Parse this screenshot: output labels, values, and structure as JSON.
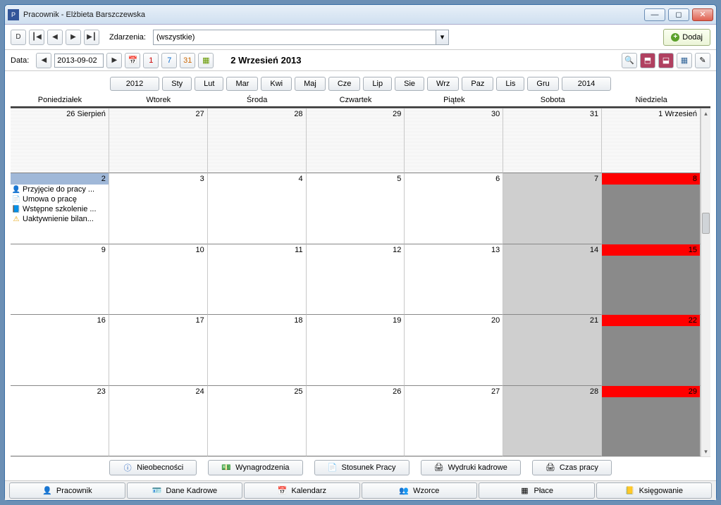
{
  "window": {
    "title": "Pracownik - Elżbieta Barszczewska"
  },
  "toolbar": {
    "events_label": "Zdarzenia:",
    "events_value": "(wszystkie)",
    "add_label": "Dodaj",
    "date_label": "Data:",
    "date_value": "2013-09-02",
    "selected_date": "2 Wrzesień 2013"
  },
  "months": {
    "prev_year": "2012",
    "list": [
      "Sty",
      "Lut",
      "Mar",
      "Kwi",
      "Maj",
      "Cze",
      "Lip",
      "Sie",
      "Wrz",
      "Paz",
      "Lis",
      "Gru"
    ],
    "next_year": "2014"
  },
  "weekdays": [
    "Poniedziałek",
    "Wtorek",
    "Środa",
    "Czwartek",
    "Piątek",
    "Sobota",
    "Niedziela"
  ],
  "grid": [
    [
      "26 Sierpień",
      "27",
      "28",
      "29",
      "30",
      "31",
      "1 Wrzesień"
    ],
    [
      "2",
      "3",
      "4",
      "5",
      "6",
      "7",
      "8"
    ],
    [
      "9",
      "10",
      "11",
      "12",
      "13",
      "14",
      "15"
    ],
    [
      "16",
      "17",
      "18",
      "19",
      "20",
      "21",
      "22"
    ],
    [
      "23",
      "24",
      "25",
      "26",
      "27",
      "28",
      "29"
    ]
  ],
  "events_day2": [
    "Przyjęcie do pracy ...",
    "Umowa o pracę",
    "Wstępne szkolenie ...",
    "Uaktywnienie bilan..."
  ],
  "actions": {
    "a1": "Nieobecności",
    "a2": "Wynagrodzenia",
    "a3": "Stosunek Pracy",
    "a4": "Wydruki kadrowe",
    "a5": "Czas pracy"
  },
  "tabs": {
    "t1": "Pracownik",
    "t2": "Dane Kadrowe",
    "t3": "Kalendarz",
    "t4": "Wzorce",
    "t5": "Płace",
    "t6": "Księgowanie"
  }
}
